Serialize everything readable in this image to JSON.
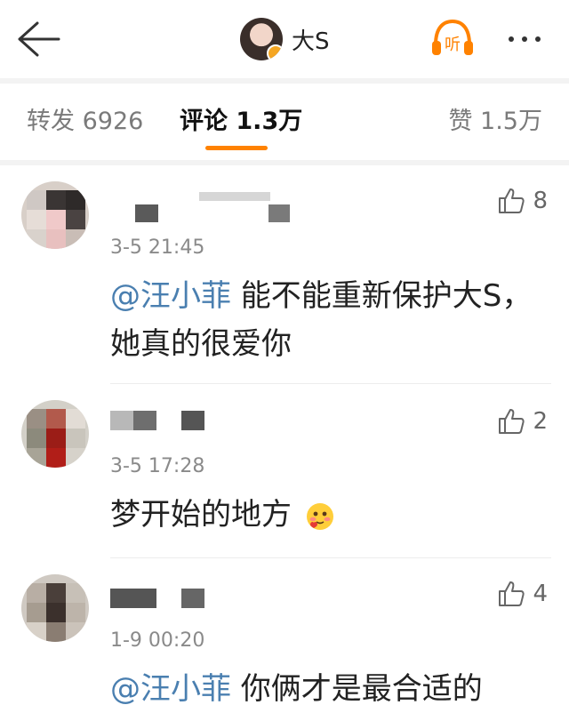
{
  "header": {
    "title": "大S",
    "listen_label": "听",
    "icons": [
      "arrow-left-icon",
      "headphones-icon",
      "more-icon"
    ]
  },
  "tabs": [
    {
      "label": "转发 6926"
    },
    {
      "label": "评论 1.3万"
    },
    {
      "label": "赞 1.5万"
    }
  ],
  "comments": [
    {
      "time": "3-5 21:45",
      "likes": "8",
      "mention": "@汪小菲",
      "text": " 能不能重新保护大S，她真的很爱你"
    },
    {
      "time": "3-5 17:28",
      "likes": "2",
      "mention": "",
      "text": "梦开始的地方",
      "emoji": "shy-face-emoji"
    },
    {
      "time": "1-9 00:20",
      "likes": "4",
      "mention": "@汪小菲",
      "text": " 你俩才是最合适的"
    }
  ],
  "colors": {
    "accent": "#ff8200",
    "mention": "#4a7fb0",
    "badge": "#f5a623"
  }
}
